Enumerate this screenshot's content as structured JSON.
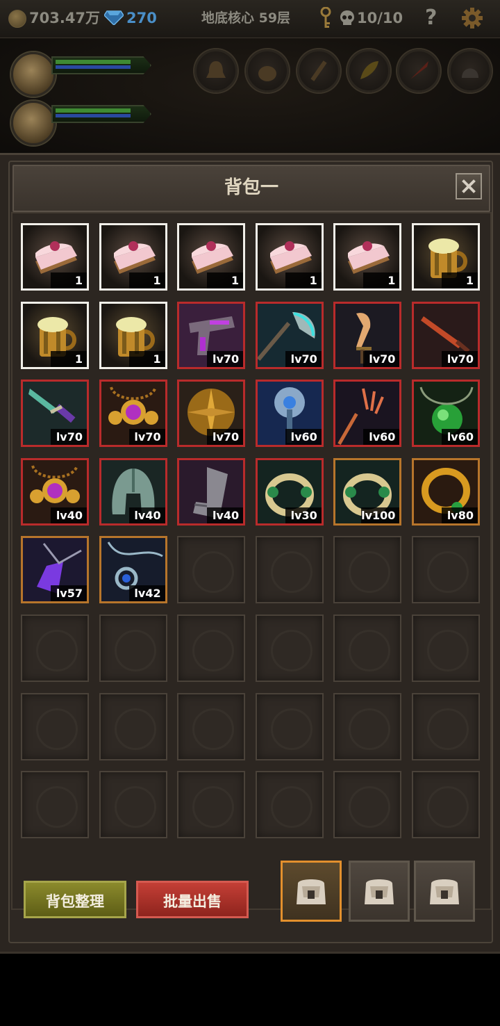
{
  "topbar": {
    "gold": "703.47万",
    "gems": "270",
    "floor": "地底核心 59层",
    "keys_skull": "10/10",
    "help": "?"
  },
  "panel": {
    "title": "背包一"
  },
  "items": [
    {
      "kind": "cake",
      "rarity": "white",
      "label": "1"
    },
    {
      "kind": "cake",
      "rarity": "white",
      "label": "1"
    },
    {
      "kind": "cake",
      "rarity": "white",
      "label": "1"
    },
    {
      "kind": "cake",
      "rarity": "white",
      "label": "1"
    },
    {
      "kind": "cake",
      "rarity": "white",
      "label": "1"
    },
    {
      "kind": "beer",
      "rarity": "white",
      "label": "1"
    },
    {
      "kind": "beer",
      "rarity": "white",
      "label": "1"
    },
    {
      "kind": "beer",
      "rarity": "white",
      "label": "1"
    },
    {
      "kind": "gun",
      "rarity": "red",
      "label": "lv70"
    },
    {
      "kind": "axe",
      "rarity": "red",
      "label": "lv70"
    },
    {
      "kind": "blade",
      "rarity": "red",
      "label": "lv70"
    },
    {
      "kind": "dagger",
      "rarity": "red",
      "label": "lv70"
    },
    {
      "kind": "sword",
      "rarity": "red",
      "label": "lv70"
    },
    {
      "kind": "necklace-gold",
      "rarity": "red",
      "label": "lv70"
    },
    {
      "kind": "shield-gold",
      "rarity": "red",
      "label": "lv70"
    },
    {
      "kind": "staff-blue",
      "rarity": "red",
      "label": "lv60"
    },
    {
      "kind": "trident",
      "rarity": "red",
      "label": "lv60"
    },
    {
      "kind": "amulet-green",
      "rarity": "red",
      "label": "lv60"
    },
    {
      "kind": "necklace-gold",
      "rarity": "red",
      "label": "lv40"
    },
    {
      "kind": "helmet",
      "rarity": "red",
      "label": "lv40"
    },
    {
      "kind": "boots",
      "rarity": "red",
      "label": "lv40"
    },
    {
      "kind": "ring-green",
      "rarity": "red",
      "label": "lv30"
    },
    {
      "kind": "ring-green",
      "rarity": "orange",
      "label": "lv100"
    },
    {
      "kind": "ring-gold",
      "rarity": "orange",
      "label": "lv80"
    },
    {
      "kind": "pendant-purple",
      "rarity": "orange",
      "label": "lv57"
    },
    {
      "kind": "pendant-blue",
      "rarity": "orange",
      "label": "lv42"
    }
  ],
  "grid": {
    "rows": 8,
    "cols": 6
  },
  "buttons": {
    "sort": "背包整理",
    "sell": "批量出售"
  },
  "bag_tabs": [
    {
      "name": "bag-1",
      "active": true
    },
    {
      "name": "bag-2",
      "active": false
    },
    {
      "name": "bag-3",
      "active": false
    }
  ],
  "colors": {
    "white": "#f1efe9",
    "red": "#b92b2b",
    "orange": "#b7752b",
    "active_tab": "#e3902d"
  }
}
